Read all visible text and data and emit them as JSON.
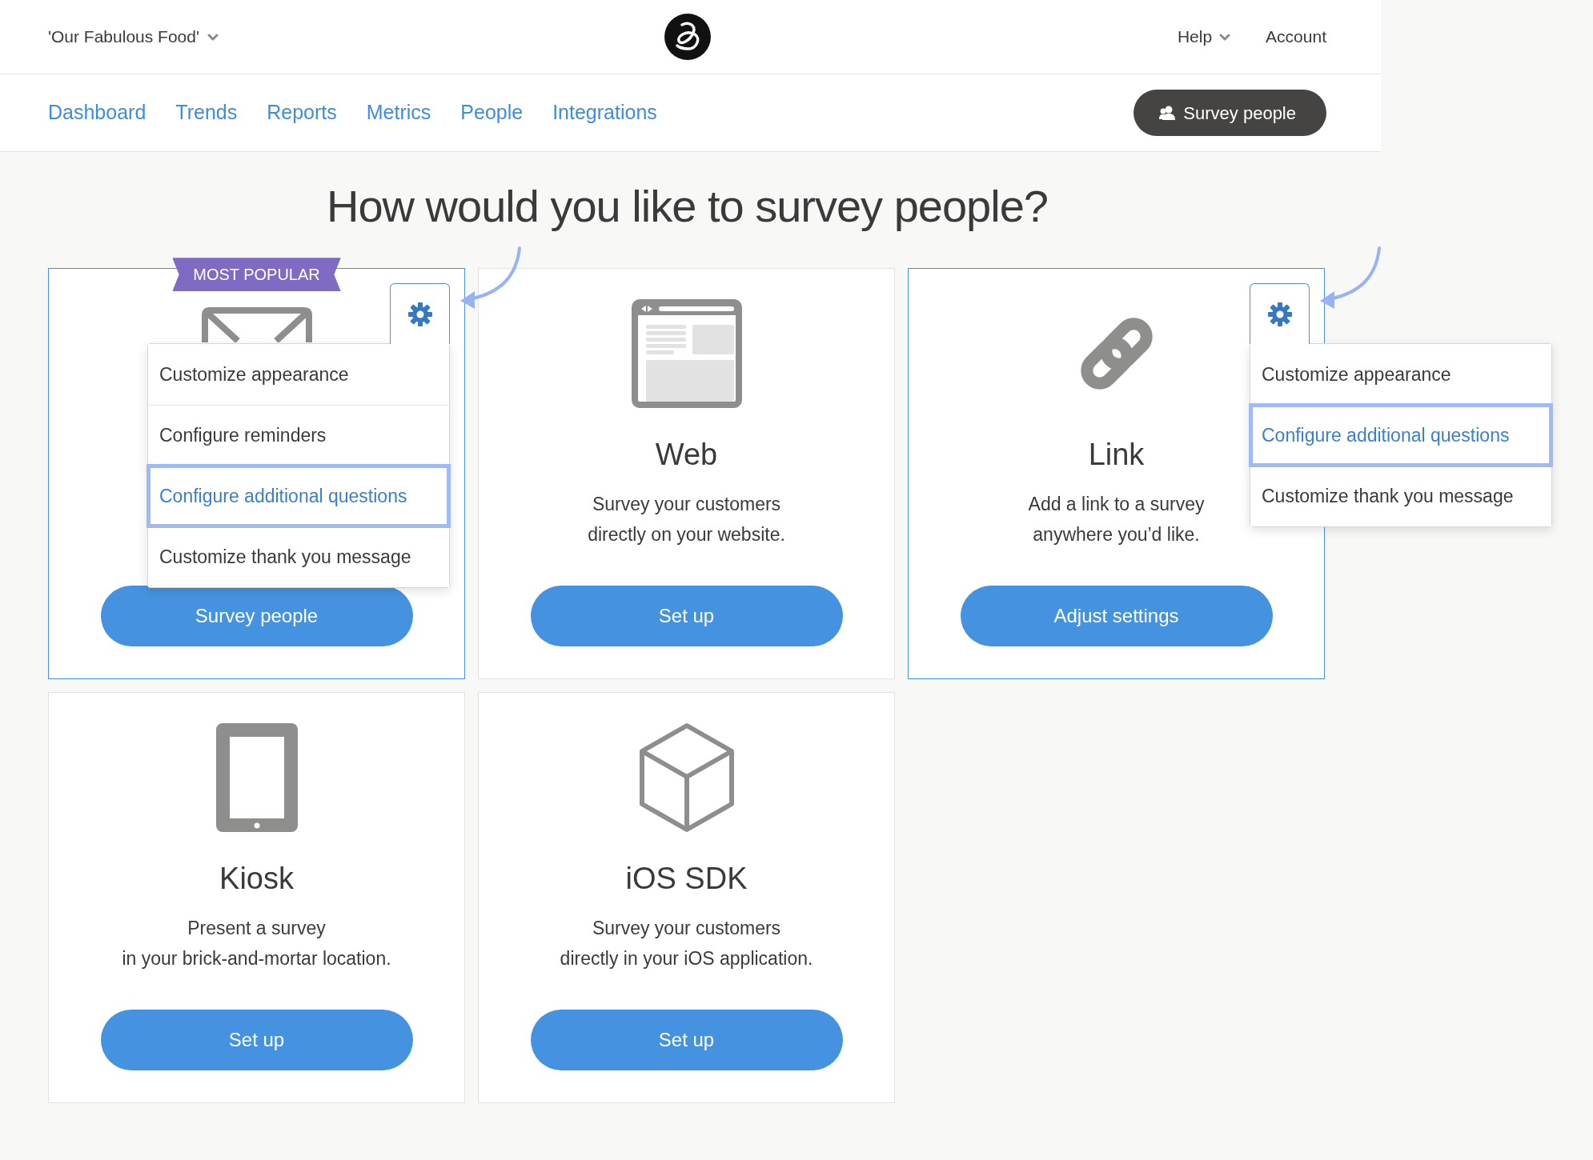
{
  "header": {
    "account": "'Our Fabulous Food'",
    "links": [
      {
        "label": "Help",
        "kind": "dropdown"
      },
      {
        "label": "Account",
        "kind": "link"
      }
    ]
  },
  "nav": {
    "tabs": [
      {
        "label": "Dashboard"
      },
      {
        "label": "Trends"
      },
      {
        "label": "Reports"
      },
      {
        "label": "Metrics"
      },
      {
        "label": "People"
      },
      {
        "label": "Integrations"
      }
    ],
    "action": "Survey people"
  },
  "heading": "How would you like to survey people?",
  "cards": [
    {
      "kind": "email",
      "active": true,
      "badge": "MOST POPULAR",
      "callout": true,
      "menu": [
        {
          "label": "Customize appearance",
          "highlighted": false
        },
        {
          "label": "Configure reminders",
          "highlighted": false
        },
        {
          "label": "Configure additional questions",
          "highlighted": true
        },
        {
          "label": "Customize thank you message",
          "highlighted": false
        }
      ],
      "button": "Survey people"
    },
    {
      "kind": "web",
      "active": false,
      "title": "Web",
      "description": [
        "Survey your customers",
        "directly on your website."
      ],
      "button": "Set up"
    },
    {
      "kind": "link",
      "active": true,
      "callout": true,
      "title": "Link",
      "description": [
        "Add a link to a survey",
        "anywhere you’d like."
      ],
      "menu": [
        {
          "label": "Customize appearance",
          "highlighted": false
        },
        {
          "label": "Configure additional questions",
          "highlighted": true
        },
        {
          "label": "Customize thank you message",
          "highlighted": false
        }
      ],
      "button": "Adjust settings"
    },
    {
      "kind": "kiosk",
      "active": false,
      "title": "Kiosk",
      "description": [
        "Present a survey",
        "in your brick-and-mortar location."
      ],
      "button": "Set up"
    },
    {
      "kind": "ios",
      "active": false,
      "title": "iOS SDK",
      "description": [
        "Survey your customers",
        "directly in your iOS application."
      ],
      "button": "Set up"
    }
  ]
}
